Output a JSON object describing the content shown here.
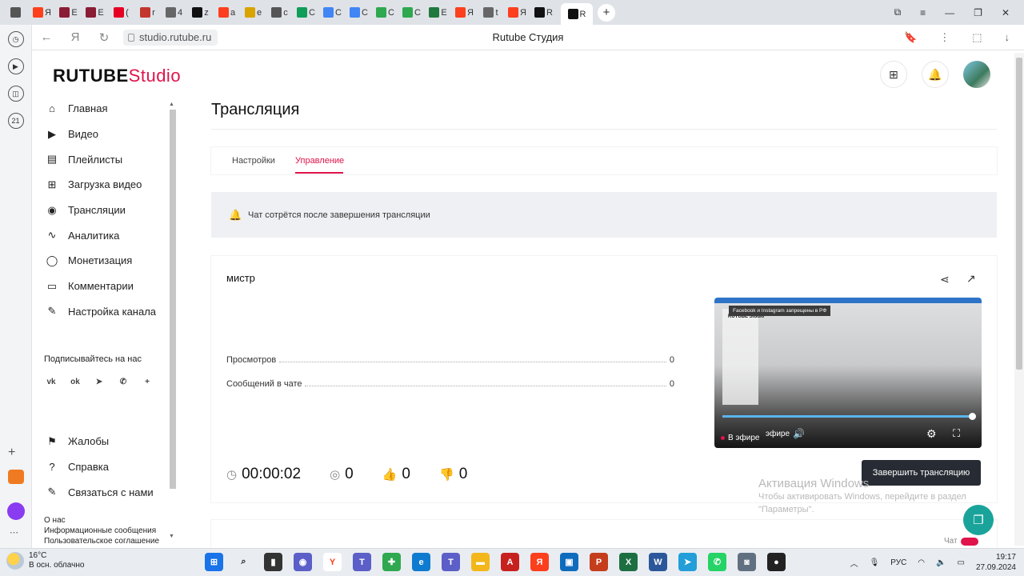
{
  "browser": {
    "url": "studio.rutube.ru",
    "page_title": "Rutube Студия",
    "tabs": [
      {
        "icon": "profile-icon",
        "color": "#555"
      },
      {
        "icon": "yandex-icon",
        "color": "#fc3f1d",
        "letter": "Я"
      },
      {
        "icon": "tab-icon",
        "color": "#8a1c34",
        "letter": "E"
      },
      {
        "icon": "tab-icon",
        "color": "#8a1c34",
        "letter": "E"
      },
      {
        "icon": "pinterest-icon",
        "color": "#e60023",
        "letter": "("
      },
      {
        "icon": "tab-icon",
        "color": "#c2362d",
        "letter": "r"
      },
      {
        "icon": "doc-icon",
        "color": "#666",
        "letter": "4"
      },
      {
        "icon": "plus-icon",
        "color": "#111",
        "letter": "z"
      },
      {
        "icon": "yandex-icon",
        "color": "#fc3f1d",
        "letter": "a"
      },
      {
        "icon": "image-icon",
        "color": "#d9a300",
        "letter": "e"
      },
      {
        "icon": "tab-icon",
        "color": "#555",
        "letter": "c"
      },
      {
        "icon": "drive-icon",
        "color": "#0f9d58",
        "letter": "C"
      },
      {
        "icon": "google-icon",
        "color": "#4285f4",
        "letter": "C"
      },
      {
        "icon": "google-icon",
        "color": "#4285f4",
        "letter": "C"
      },
      {
        "icon": "plus-icon",
        "color": "#2fa84f",
        "letter": "C"
      },
      {
        "icon": "plus-icon",
        "color": "#2fa84f",
        "letter": "C"
      },
      {
        "icon": "tab-icon",
        "color": "#1f7a3d",
        "letter": "E"
      },
      {
        "icon": "yandex-icon",
        "color": "#fc3f1d",
        "letter": "Я"
      },
      {
        "icon": "doc-icon",
        "color": "#666",
        "letter": "t"
      },
      {
        "icon": "yandex-icon",
        "color": "#fc3f1d",
        "letter": "Я"
      },
      {
        "icon": "rutube-icon",
        "color": "#111",
        "letter": "R"
      },
      {
        "icon": "rutube-icon",
        "color": "#111",
        "letter": "R"
      }
    ]
  },
  "app": {
    "logo_main": "RUTUBE",
    "logo_sub": "Studio",
    "brand_color": "#e0134a"
  },
  "sidebar": {
    "items": [
      {
        "label": "Главная",
        "icon": "home-icon",
        "glyph": "⌂"
      },
      {
        "label": "Видео",
        "icon": "video-icon",
        "glyph": "▶"
      },
      {
        "label": "Плейлисты",
        "icon": "playlist-icon",
        "glyph": "▤"
      },
      {
        "label": "Загрузка видео",
        "icon": "upload-icon",
        "glyph": "⊞"
      },
      {
        "label": "Трансляции",
        "icon": "broadcast-icon",
        "glyph": "◉"
      },
      {
        "label": "Аналитика",
        "icon": "analytics-icon",
        "glyph": "∿"
      },
      {
        "label": "Монетизация",
        "icon": "money-icon",
        "glyph": "◯"
      },
      {
        "label": "Комментарии",
        "icon": "comments-icon",
        "glyph": "▭"
      },
      {
        "label": "Настройка канала",
        "icon": "magic-wand-icon",
        "glyph": "✎"
      }
    ],
    "follow_label": "Подписывайтесь на нас",
    "socials": [
      "vk",
      "ok",
      "tg",
      "vb",
      "+"
    ],
    "bottom_items": [
      {
        "label": "Жалобы",
        "icon": "flag-icon",
        "glyph": "⚑"
      },
      {
        "label": "Справка",
        "icon": "help-icon",
        "glyph": "?"
      },
      {
        "label": "Связаться с нами",
        "icon": "pen-icon",
        "glyph": "✎"
      }
    ],
    "footer_links": [
      "О нас",
      "Информационные сообщения",
      "Пользовательское соглашение"
    ]
  },
  "page": {
    "title": "Трансляция",
    "tabs": [
      "Настройки",
      "Управление"
    ],
    "active_tab": "Управление",
    "notice": "Чат сотрётся после завершения трансляции"
  },
  "stream": {
    "name": "мистр",
    "stats": [
      {
        "label": "Просмотров",
        "value": "0"
      },
      {
        "label": "Сообщений в чате",
        "value": "0"
      }
    ],
    "timer": "00:00:02",
    "viewers": "0",
    "likes": "0",
    "dislikes": "0",
    "player": {
      "fb_note": "Facebook и Instagram запрещены в РФ",
      "live_label": "В эфире",
      "live_label_partial": "эфире",
      "mini_logo": "RUTUBE Studio"
    },
    "end_button": "Завершить трансляцию"
  },
  "watermark": {
    "line1": "Активация Windows",
    "line2": "Чтобы активировать Windows, перейдите в раздел",
    "line3": "\"Параметры\"."
  },
  "chat_toggle_label": "Чат",
  "taskbar": {
    "weather_temp": "16°C",
    "weather_desc": "В осн. облачно",
    "lang": "РУС",
    "time": "19:17",
    "date": "27.09.2024"
  }
}
